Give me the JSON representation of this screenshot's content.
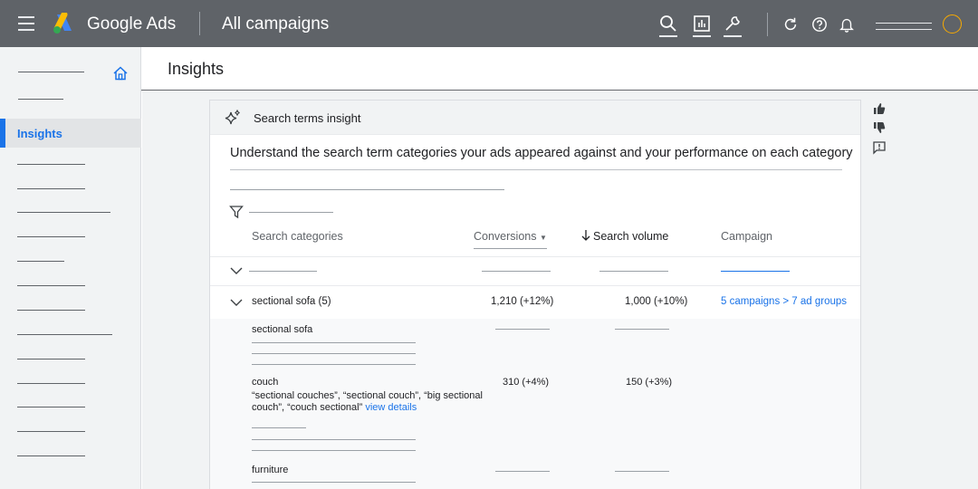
{
  "header": {
    "brand": "Google Ads",
    "title": "All campaigns",
    "icons": [
      "menu-icon",
      "google-ads-logo",
      "search-icon",
      "reports-icon",
      "tools-icon",
      "refresh-icon",
      "help-icon",
      "notifications-icon",
      "avatar"
    ]
  },
  "sidebar": {
    "active_label": "Insights",
    "icons": [
      "home-icon"
    ]
  },
  "page": {
    "title": "Insights"
  },
  "card": {
    "header_label": "Search terms insight",
    "description": "Understand the search term categories your ads appeared against and your performance on each category",
    "columns": {
      "categories": "Search categories",
      "conversions": "Conversions",
      "search_volume": "Search volume",
      "campaign": "Campaign"
    },
    "row": {
      "category": "sectional sofa (5)",
      "conversions": "1,210 (+12%)",
      "search_volume": "1,000 (+10%)",
      "campaign": "5 campaigns > 7 ad groups"
    },
    "terms": [
      {
        "name": "sectional sofa"
      },
      {
        "name": "couch",
        "examples": "“sectional couches”, “sectional couch”, “big sectional couch”, “couch sectional”",
        "link": "view details",
        "conversions": "310 (+4%)",
        "search_volume": "150 (+3%)"
      },
      {
        "name": "furniture"
      }
    ]
  },
  "colors": {
    "accent": "#1a73e8",
    "topbar": "#5f6368",
    "avatar_ring": "#f9ab00"
  }
}
